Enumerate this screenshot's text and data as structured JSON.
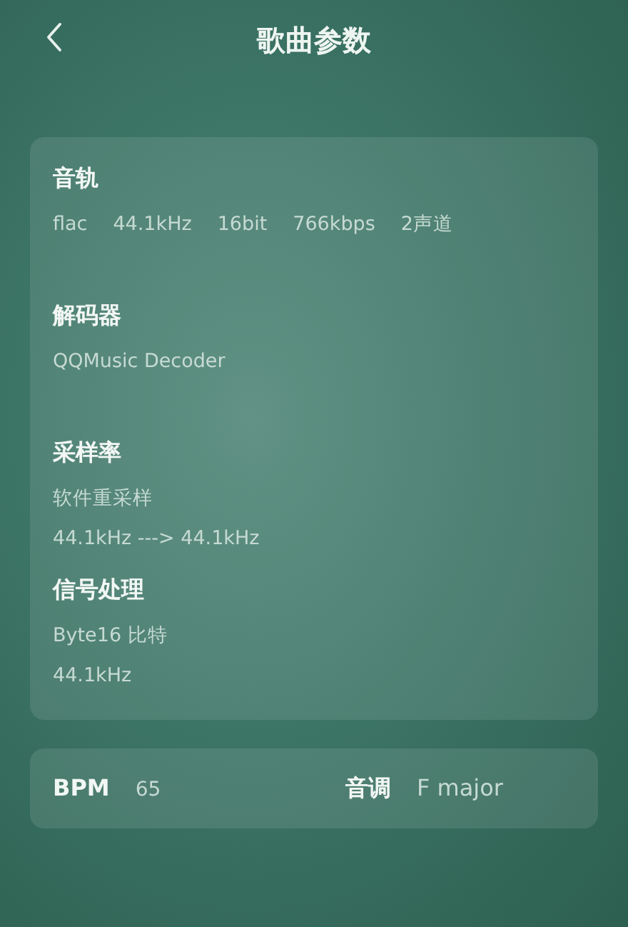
{
  "header": {
    "title": "歌曲参数"
  },
  "sections": [
    {
      "title": "音轨",
      "kind": "inline",
      "values": [
        "flac",
        "44.1kHz",
        "16bit",
        "766kbps",
        "2声道"
      ]
    },
    {
      "title": "解码器",
      "kind": "stacked",
      "values": [
        "QQMusic Decoder"
      ]
    },
    {
      "title": "采样率",
      "kind": "stacked",
      "values": [
        "软件重采样",
        "44.1kHz ---> 44.1kHz"
      ]
    },
    {
      "title": "信号处理",
      "kind": "stacked",
      "values": [
        "Byte16 比特",
        "44.1kHz"
      ]
    }
  ],
  "summary": [
    {
      "label": "BPM",
      "value": "65"
    },
    {
      "label": "音调",
      "value": "F major"
    }
  ]
}
